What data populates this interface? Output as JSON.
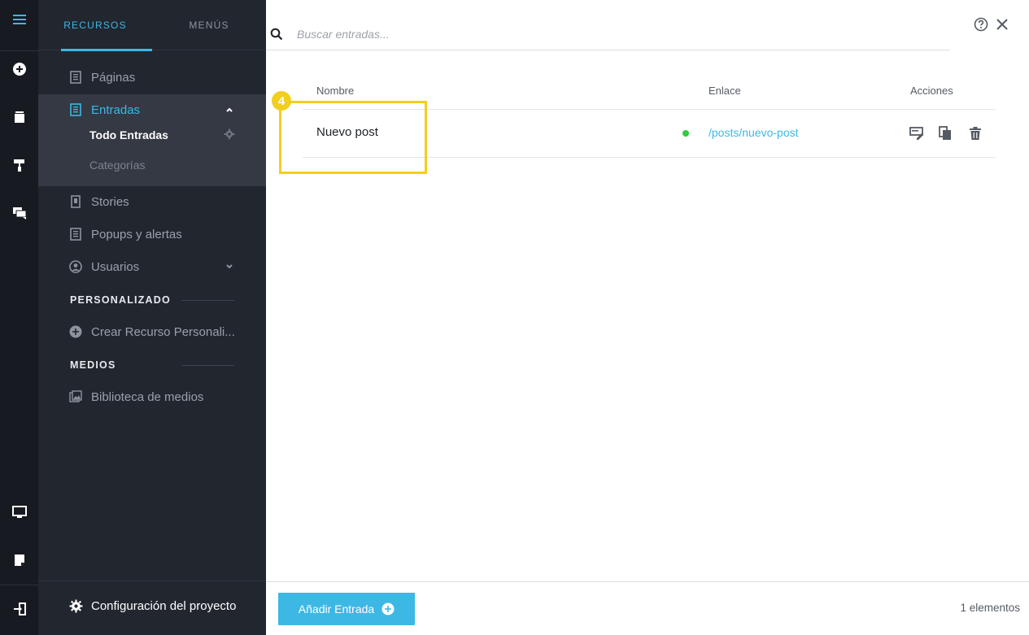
{
  "sidebar": {
    "tabs": [
      {
        "label": "RECURSOS",
        "active": true
      },
      {
        "label": "MENÚS",
        "active": false
      }
    ],
    "items": {
      "paginas": "Páginas",
      "entradas": "Entradas",
      "entradas_sub": [
        "Todo Entradas",
        "Categorías"
      ],
      "stories": "Stories",
      "popups": "Popups y alertas",
      "usuarios": "Usuarios"
    },
    "section_custom": "PERSONALIZADO",
    "create_custom": "Crear Recurso Personali...",
    "section_media": "MEDIOS",
    "media_library": "Biblioteca de medios",
    "footer": "Configuración del proyecto"
  },
  "search": {
    "placeholder": "Buscar entradas...",
    "value": ""
  },
  "table": {
    "columns": [
      "Nombre",
      "Enlace",
      "Acciones"
    ],
    "rows": [
      {
        "name": "Nuevo post",
        "status": "published",
        "link": "/posts/nuevo-post",
        "actions": [
          "edit-icon",
          "duplicate-icon",
          "delete-icon"
        ]
      }
    ]
  },
  "annotation": {
    "badge": "4"
  },
  "footer": {
    "add_button": "Añadir Entrada",
    "count": "1 elementos"
  },
  "colors": {
    "accent": "#3db8e4",
    "sidebar_bg": "#22262f",
    "rail_bg": "#171a21",
    "status_green": "#2ecc40",
    "highlight": "#f2cf1f"
  }
}
